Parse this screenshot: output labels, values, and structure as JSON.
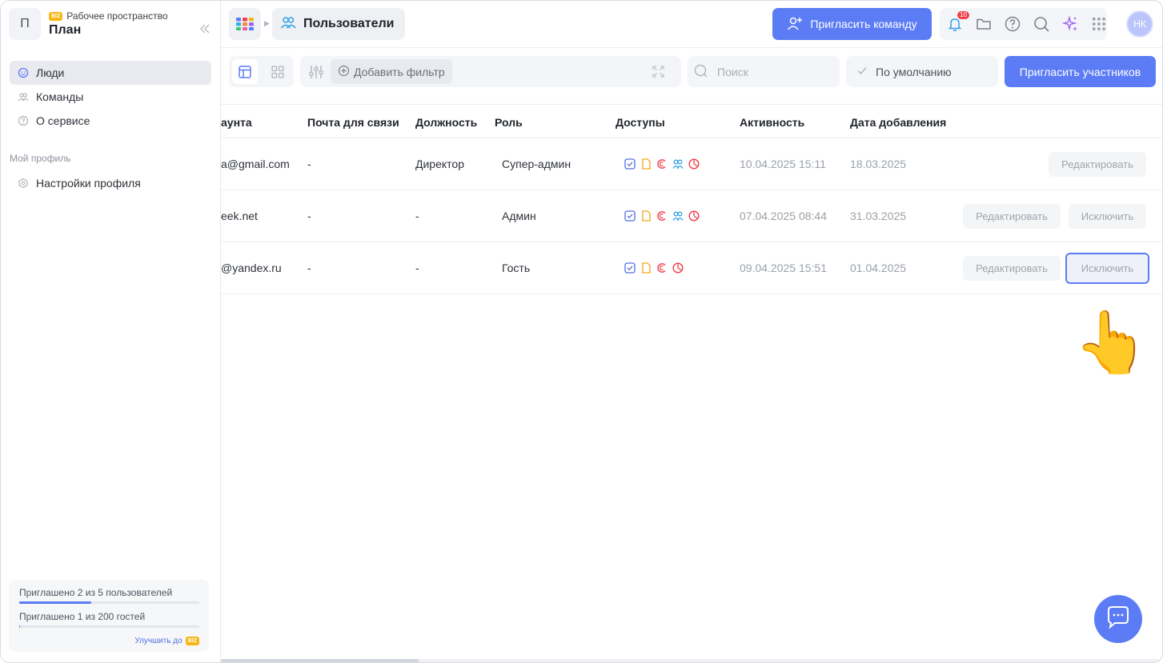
{
  "workspace": {
    "avatar_letter": "П",
    "subtitle": "Рабочее пространство",
    "badge": "BIZ",
    "name": "План"
  },
  "sidebar": {
    "items": [
      {
        "label": "Люди",
        "icon": "smile-icon",
        "active": true
      },
      {
        "label": "Команды",
        "icon": "team-icon",
        "active": false
      },
      {
        "label": "О сервисе",
        "icon": "help-circle-icon",
        "active": false
      }
    ],
    "profile_section": "Мой профиль",
    "profile_items": [
      {
        "label": "Настройки профиля",
        "icon": "settings-hex-icon"
      }
    ],
    "usage": {
      "users_label": "Приглашено 2 из 5 пользователей",
      "users_progress": 0.4,
      "guests_label": "Приглашено 1 из 200 гостей",
      "guests_progress": 0.005,
      "upgrade_label": "Улучшить до",
      "upgrade_badge": "BIZ"
    }
  },
  "header": {
    "breadcrumb": "Пользователи",
    "invite_team_label": "Пригласить команду",
    "notifications_count": "10",
    "avatar_initials": "НК"
  },
  "toolbar": {
    "add_filter_label": "Добавить фильтр",
    "search_placeholder": "Поиск",
    "sort_label": "По умолчанию",
    "invite_members_label": "Пригласить участников"
  },
  "table": {
    "columns": [
      "аунта",
      "Почта для связи",
      "Должность",
      "Роль",
      "Доступы",
      "Активность",
      "Дата добавления"
    ],
    "rows": [
      {
        "account": "a@gmail.com",
        "contact_email": "-",
        "position": "Директор",
        "role": "Супер-админ",
        "access": [
          "tasks-icon",
          "docs-icon",
          "crm-icon",
          "team-icon",
          "analytics-icon"
        ],
        "activity": "10.04.2025 15:11",
        "added": "18.03.2025",
        "edit_label": "Редактировать",
        "exclude_label": ""
      },
      {
        "account": "eek.net",
        "contact_email": "-",
        "position": "-",
        "role": "Админ",
        "access": [
          "tasks-icon",
          "docs-icon",
          "crm-icon",
          "team-icon",
          "analytics-icon"
        ],
        "activity": "07.04.2025 08:44",
        "added": "31.03.2025",
        "edit_label": "Редактировать",
        "exclude_label": "Исключить"
      },
      {
        "account": "@yandex.ru",
        "contact_email": "-",
        "position": "-",
        "role": "Гость",
        "access": [
          "tasks-icon",
          "docs-icon",
          "crm-icon",
          "analytics-icon"
        ],
        "activity": "09.04.2025 15:51",
        "added": "01.04.2025",
        "edit_label": "Редактировать",
        "exclude_label": "Исключить"
      }
    ]
  },
  "colors": {
    "accent": "#5b7cf5",
    "danger": "#f0404b",
    "biz_badge": "#f5b716"
  }
}
